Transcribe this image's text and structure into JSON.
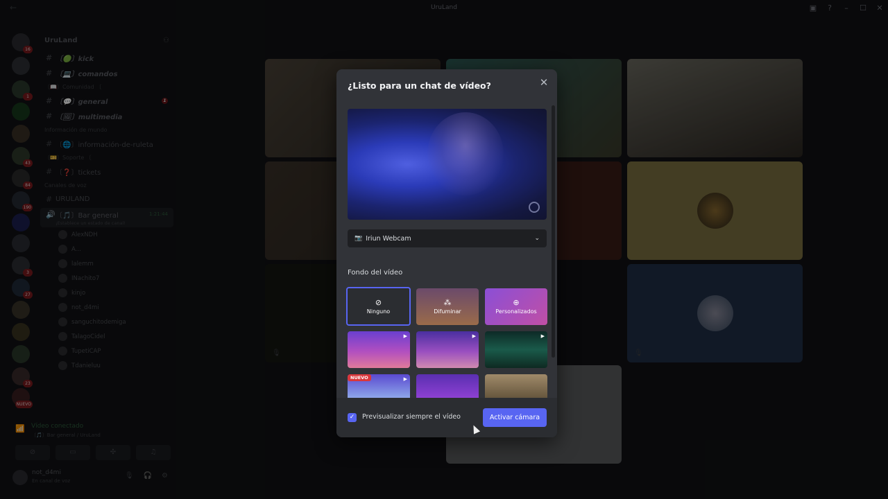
{
  "window": {
    "title": "UruLand",
    "icons": [
      "back-arrow-icon",
      "inbox-icon",
      "help-icon",
      "minimize-icon",
      "maximize-icon",
      "close-icon"
    ]
  },
  "servers": [
    {
      "name": "direct-messages",
      "badge": "16",
      "color": "#2a2b30"
    },
    {
      "name": "server-1",
      "badge": "",
      "color": "#2f3035"
    },
    {
      "name": "server-2",
      "badge": "1",
      "color": "#2b3a2c"
    },
    {
      "name": "kick",
      "badge": "",
      "color": "#173a1c"
    },
    {
      "name": "server-4",
      "badge": "",
      "color": "#3a3026"
    },
    {
      "name": "server-5",
      "badge": "43",
      "color": "#2e3a2a"
    },
    {
      "name": "fk",
      "badge": "84",
      "color": "#2a2a2a"
    },
    {
      "name": "server-7",
      "badge": "190",
      "color": "#262b33"
    },
    {
      "name": "server-8",
      "badge": "",
      "color": "#1c2050"
    },
    {
      "name": "server-9",
      "badge": "",
      "color": "#2a2d33"
    },
    {
      "name": "server-10",
      "badge": "3",
      "color": "#2d2f34"
    },
    {
      "name": "server-11",
      "badge": "27",
      "color": "#1f2b3a"
    },
    {
      "name": "server-12",
      "badge": "",
      "color": "#3a3428"
    },
    {
      "name": "server-13",
      "badge": "",
      "color": "#3a3320"
    },
    {
      "name": "server-14",
      "badge": "",
      "color": "#2b3a2a"
    },
    {
      "name": "server-15",
      "badge": "23",
      "color": "#3a2a2a"
    },
    {
      "name": "nuevo",
      "badge": "NUEVO",
      "color": "#3a1e20"
    }
  ],
  "sidebar": {
    "guild_name": "UruLand",
    "channels": [
      {
        "label": "〔🟢〕kick",
        "style": "bold",
        "unread": ""
      },
      {
        "label": "〔💻〕comandos",
        "style": "bold",
        "unread": ""
      },
      {
        "category": "〔📖〕Comunidad 〔"
      },
      {
        "label": "〔💬〕general",
        "style": "bold",
        "unread": "1"
      },
      {
        "label": "〔🖼〕multimedia",
        "style": "bold",
        "unread": ""
      },
      {
        "category": "Información de mundo"
      },
      {
        "label": "〔🌐〕información-de-ruleta",
        "style": "normal",
        "unread": ""
      },
      {
        "category": "〔🎫〕Soporte 〔"
      },
      {
        "label": "〔❓〕tickets",
        "style": "normal",
        "unread": ""
      },
      {
        "category": "Canales de voz"
      },
      {
        "label": "URULAND",
        "style": "normal",
        "unread": ""
      }
    ],
    "active_voice": {
      "label": "〔🎵〕Bar general",
      "time": "1:21:44",
      "status": "¡Establece un estado de canal!"
    },
    "voice_users": [
      "AlexNDH",
      "A...",
      "lalemm",
      "INachito7",
      "kinjo",
      "not_d4mi",
      "sanguchitodemiga",
      "TalagoCidel",
      "TupetiCAP",
      "Tdanieluu"
    ]
  },
  "voice_panel": {
    "title": "Vídeo conectado",
    "subtitle": "〔🎵〕Bar general / UruLand",
    "buttons": [
      "camera-off-icon",
      "screen-share-icon",
      "activities-icon",
      "soundboard-icon"
    ]
  },
  "user_panel": {
    "username": "not_d4mi",
    "status": "En canal de voz"
  },
  "modal": {
    "title": "¿Listo para un chat de vídeo?",
    "camera_select": "Iriun Webcam",
    "section_title": "Fondo del vídeo",
    "background_options": [
      {
        "label": "Ninguno",
        "icon": "⊘",
        "kind": "none",
        "selected": true
      },
      {
        "label": "Difuminar",
        "icon": "⁂",
        "kind": "blur",
        "selected": false
      },
      {
        "label": "Personalizados",
        "icon": "⊕",
        "kind": "custom",
        "selected": false
      }
    ],
    "new_badge": "NUEVO",
    "always_preview_label": "Previsualizar siempre el vídeo",
    "always_preview_checked": true,
    "activate_button": "Activar cámara"
  },
  "colors": {
    "accent": "#5865f2",
    "modal_bg": "#313338",
    "input_bg": "#1e1f22",
    "danger": "#da373c"
  }
}
